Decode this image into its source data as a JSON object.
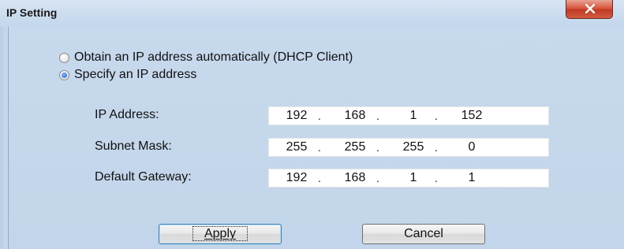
{
  "window": {
    "title": "IP Setting",
    "close_icon": "close-x-icon"
  },
  "mode": {
    "options": [
      {
        "label": "Obtain an IP address automatically (DHCP Client)",
        "checked": false
      },
      {
        "label": "Specify an IP address",
        "checked": true
      }
    ]
  },
  "fields": {
    "ip_address": {
      "label": "IP Address:",
      "octets": [
        "192",
        "168",
        "1",
        "152"
      ]
    },
    "subnet_mask": {
      "label": "Subnet Mask:",
      "octets": [
        "255",
        "255",
        "255",
        "0"
      ]
    },
    "default_gateway": {
      "label": "Default Gateway:",
      "octets": [
        "192",
        "168",
        "1",
        "1"
      ]
    }
  },
  "buttons": {
    "apply": "Apply",
    "cancel": "Cancel"
  }
}
